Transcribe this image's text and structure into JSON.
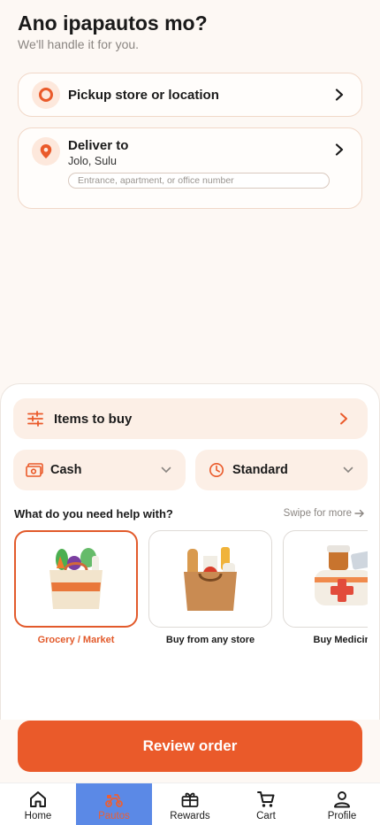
{
  "header": {
    "title": "Ano ipapautos mo?",
    "subtitle": "We'll handle it for you."
  },
  "pickup": {
    "label": "Pickup store or location"
  },
  "deliver": {
    "label": "Deliver to",
    "location": "Jolo, Sulu",
    "address_placeholder": "Entrance, apartment, or office number",
    "address_value": ""
  },
  "sheet": {
    "items_label": "Items to buy",
    "payment_label": "Cash",
    "speed_label": "Standard",
    "help_heading": "What do you need help with?",
    "swipe_hint": "Swipe for more",
    "categories": [
      {
        "label": "Grocery / Market",
        "selected": true
      },
      {
        "label": "Buy from any store",
        "selected": false
      },
      {
        "label": "Buy Medicine",
        "selected": false
      }
    ]
  },
  "review_button": "Review order",
  "nav": {
    "items": [
      {
        "label": "Home",
        "icon": "home-icon"
      },
      {
        "label": "Pautos",
        "icon": "scooter-icon",
        "active": true
      },
      {
        "label": "Rewards",
        "icon": "gift-icon"
      },
      {
        "label": "Cart",
        "icon": "cart-icon"
      },
      {
        "label": "Profile",
        "icon": "person-icon"
      }
    ]
  },
  "colors": {
    "accent": "#ea5a2a",
    "background": "#fdf8f4",
    "pill": "#fcefe6",
    "nav_active_bg": "#5b89e6"
  }
}
